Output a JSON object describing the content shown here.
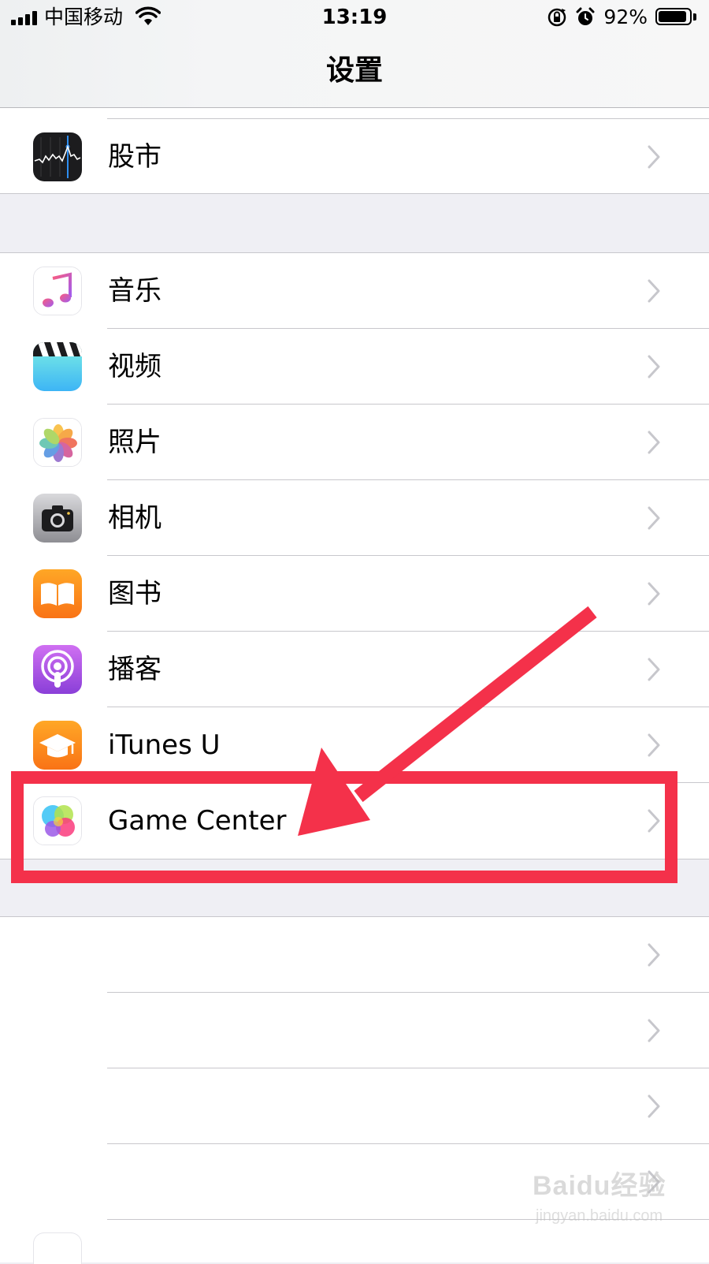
{
  "status_bar": {
    "carrier": "中国移动",
    "time": "13:19",
    "battery_percent_text": "92%",
    "battery_level": 0.92
  },
  "nav": {
    "title": "设置"
  },
  "groups": [
    {
      "items": [
        {
          "label": "股市",
          "icon": "stocks-icon"
        }
      ]
    },
    {
      "items": [
        {
          "label": "音乐",
          "icon": "music-icon"
        },
        {
          "label": "视频",
          "icon": "videos-icon"
        },
        {
          "label": "照片",
          "icon": "photos-icon"
        },
        {
          "label": "相机",
          "icon": "camera-icon"
        },
        {
          "label": "图书",
          "icon": "books-icon"
        },
        {
          "label": "播客",
          "icon": "podcasts-icon"
        },
        {
          "label": "iTunes U",
          "icon": "itunes-u-icon"
        },
        {
          "label": "Game Center",
          "icon": "game-center-icon",
          "highlighted": true
        }
      ]
    },
    {
      "items": [
        {
          "label": ""
        },
        {
          "label": ""
        },
        {
          "label": ""
        },
        {
          "label": ""
        }
      ]
    }
  ],
  "annotation": {
    "color": "#f4314a",
    "target": "Game Center"
  },
  "watermark": {
    "brand": "Baidu经验",
    "url": "jingyan.baidu.com"
  },
  "colors": {
    "chevron": "#c7c7cc",
    "separator": "#c8c7cc",
    "grouped_background": "#efeff4"
  }
}
